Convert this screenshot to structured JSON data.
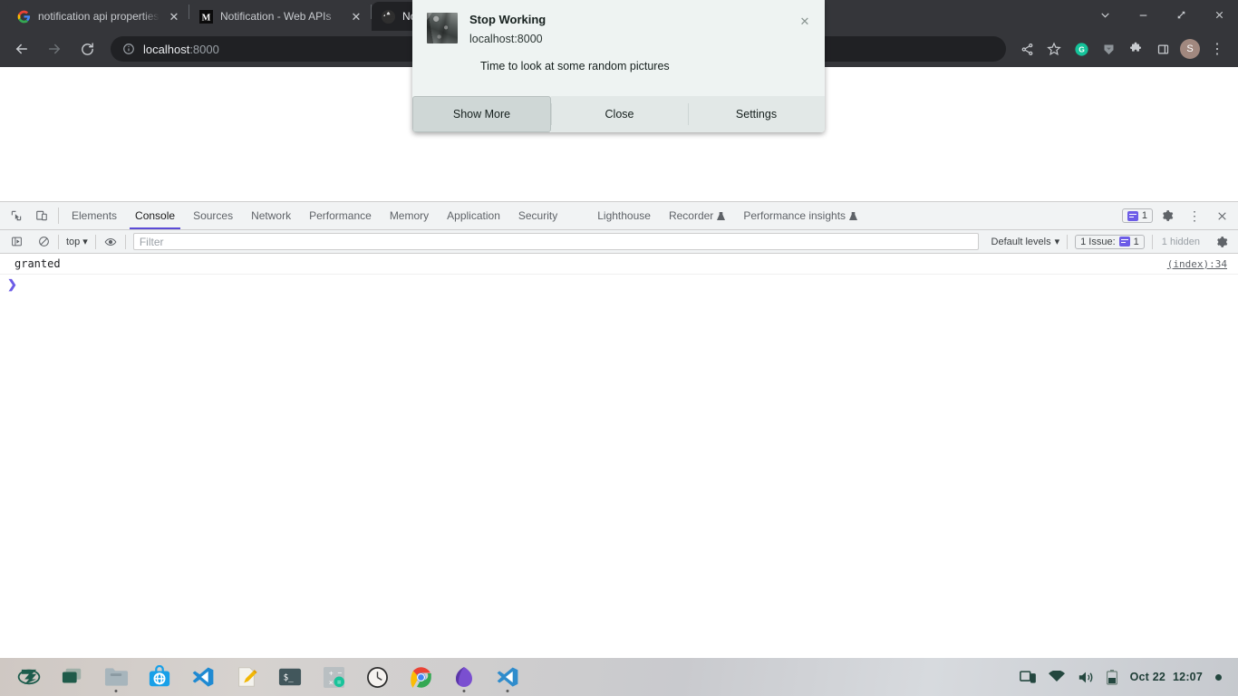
{
  "browser": {
    "tabs": [
      {
        "title": "notification api properties",
        "favicon": "google-icon",
        "active": false
      },
      {
        "title": "Notification - Web APIs",
        "favicon": "mdn-icon",
        "active": false
      },
      {
        "title": "Notification API",
        "favicon": "globe-icon",
        "active": true
      }
    ],
    "new_tab_label": "+",
    "window_controls": {
      "search_tabs": "⌄",
      "minimize": "–",
      "restore": "⤵",
      "close": "✕"
    },
    "nav": {
      "back": "←",
      "forward": "→",
      "reload": "⟳"
    },
    "omnibox": {
      "info_icon": "info-icon",
      "host": "localhost",
      "port": ":8000"
    },
    "toolbar_icons": [
      {
        "name": "share-icon",
        "glyph": "≺"
      },
      {
        "name": "bookmark-star-icon",
        "glyph": "☆"
      },
      {
        "name": "grammarly-extension-icon",
        "glyph": "G"
      },
      {
        "name": "pocket-extension-icon",
        "glyph": "◢"
      },
      {
        "name": "extensions-puzzle-icon",
        "glyph": "❖"
      },
      {
        "name": "side-panel-icon",
        "glyph": "▣"
      }
    ],
    "profile_initial": "S",
    "menu_icon": "⋮"
  },
  "notification": {
    "title": "Stop Working",
    "origin": "localhost:8000",
    "body": "Time to look at some random pictures",
    "close_label": "✕",
    "actions": [
      {
        "label": "Show More",
        "hovered": true
      },
      {
        "label": "Close",
        "hovered": false
      },
      {
        "label": "Settings",
        "hovered": false
      }
    ]
  },
  "devtools": {
    "left_icons": [
      {
        "name": "inspect-element-icon",
        "glyph": "⬚"
      },
      {
        "name": "device-toolbar-icon",
        "glyph": "❐"
      }
    ],
    "panels": [
      {
        "label": "Elements",
        "active": false,
        "warn": false
      },
      {
        "label": "Console",
        "active": true,
        "warn": false
      },
      {
        "label": "Sources",
        "active": false,
        "warn": false
      },
      {
        "label": "Network",
        "active": false,
        "warn": false
      },
      {
        "label": "Performance",
        "active": false,
        "warn": false
      },
      {
        "label": "Memory",
        "active": false,
        "warn": false
      },
      {
        "label": "Application",
        "active": false,
        "warn": false
      },
      {
        "label": "Security",
        "active": false,
        "warn": false
      },
      {
        "label": "Lighthouse",
        "active": false,
        "warn": false
      },
      {
        "label": "Recorder",
        "active": false,
        "warn": true
      },
      {
        "label": "Performance insights",
        "active": false,
        "warn": true
      }
    ],
    "issues_count": "1",
    "settings_icon": "⚙",
    "more_icon": "⋮",
    "close_icon": "✕",
    "console_toolbar": {
      "sidebar_icon": "▷",
      "clear_icon": "⊘",
      "context": "top",
      "context_caret": "▾",
      "eye_icon": "◉",
      "filter_placeholder": "Filter",
      "levels_label": "Default levels",
      "levels_caret": "▾",
      "issue_chip_label": "1 Issue:",
      "issue_chip_count": "1",
      "hidden_label": "1 hidden",
      "settings_icon": "⚙"
    },
    "logs": [
      {
        "text": "granted",
        "source": "(index):34"
      }
    ],
    "prompt": "❯"
  },
  "taskbar": {
    "apps": [
      {
        "name": "zorin-menu-icon",
        "running": false
      },
      {
        "name": "workspaces-icon",
        "running": false
      },
      {
        "name": "files-icon",
        "running": true
      },
      {
        "name": "software-center-icon",
        "running": false
      },
      {
        "name": "vscode-insiders-icon",
        "running": false
      },
      {
        "name": "text-editor-icon",
        "running": false
      },
      {
        "name": "terminal-icon",
        "running": true
      },
      {
        "name": "calculator-icon",
        "running": false
      },
      {
        "name": "clock-icon",
        "running": false
      },
      {
        "name": "chrome-icon",
        "running": true
      },
      {
        "name": "gimp-icon",
        "running": true
      },
      {
        "name": "vscode-icon",
        "running": true
      }
    ],
    "tray": [
      {
        "name": "display-icon"
      },
      {
        "name": "wifi-icon"
      },
      {
        "name": "volume-icon"
      },
      {
        "name": "battery-icon"
      }
    ],
    "date": "Oct 22",
    "time": "12:07",
    "notification_dot": "●"
  }
}
